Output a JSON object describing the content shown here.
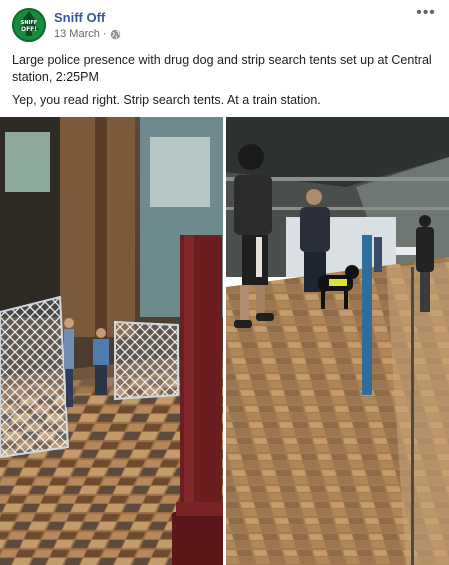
{
  "post": {
    "author": "Sniff Off",
    "avatar_text": [
      "SNIFF",
      "OFF!"
    ],
    "date": "13 March",
    "separator": "·",
    "audience_icon": "globe-icon",
    "more_icon": "more-options-icon",
    "more_label": "•••",
    "paragraphs": [
      "Large police presence with drug dog and strip search tents set up at Central station, 2:25PM",
      "Yep, you read right. Strip search tents. At a train station."
    ]
  },
  "photos": [
    {
      "subject": "train-station-platform-search-tents-photo"
    },
    {
      "subject": "police-officer-with-drug-dog-photo"
    }
  ],
  "colors": {
    "author_link": "#385898",
    "meta_text": "#616770",
    "avatar_green": "#0f6b2c",
    "floor_tile_dark": "#6e4a2e",
    "floor_tile_light": "#b58a5c",
    "pillar": "#6b1d1f"
  }
}
